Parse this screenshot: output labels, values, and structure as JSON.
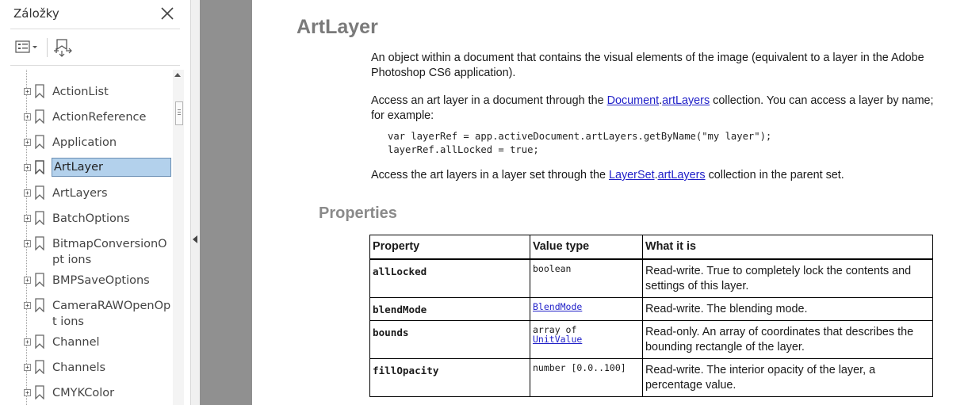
{
  "sidebar": {
    "title": "Záložky",
    "items": [
      {
        "label": "ActionList"
      },
      {
        "label": "ActionReference"
      },
      {
        "label": "Application"
      },
      {
        "label": "ArtLayer",
        "selected": true
      },
      {
        "label": "ArtLayers"
      },
      {
        "label": "BatchOptions"
      },
      {
        "label": "BitmapConversionOpt ions"
      },
      {
        "label": "BMPSaveOptions"
      },
      {
        "label": "CameraRAWOpenOpt ions"
      },
      {
        "label": "Channel"
      },
      {
        "label": "Channels"
      },
      {
        "label": "CMYKColor"
      }
    ],
    "icons": [
      "close-icon",
      "options-list-icon",
      "new-bookmark-icon",
      "bookmark-ribbon-icon",
      "plus-expander-icon"
    ]
  },
  "document": {
    "title": "ArtLayer",
    "intro": "An object within a document that contains the visual elements of the image (equivalent to a layer in the Adobe Photoshop CS6 application).",
    "access1": {
      "before": "Access an art layer in a document through the ",
      "link1": "Document",
      "dot": ".",
      "link2": "artLayers",
      "after": " collection. You can access a layer by name; for example:"
    },
    "code": "var layerRef = app.activeDocument.artLayers.getByName(\"my layer\");\nlayerRef.allLocked = true;",
    "access2": {
      "before": "Access the art layers in a layer set through the ",
      "link1": "LayerSet",
      "dot": ".",
      "link2": "artLayers",
      "after": " collection in the parent set."
    },
    "properties_title": "Properties",
    "table": {
      "headers": [
        "Property",
        "Value type",
        "What it is"
      ],
      "rows": [
        {
          "property": "allLocked",
          "type_line1": "boolean",
          "type_line2": "",
          "type_link": false,
          "desc": "Read-write. True to completely lock the contents and settings of this layer."
        },
        {
          "property": "blendMode",
          "type_line1": "",
          "type_line2": "BlendMode",
          "type_link": true,
          "desc": "Read-write. The blending mode."
        },
        {
          "property": "bounds",
          "type_line1": "array of",
          "type_line2": "UnitValue",
          "type_link": true,
          "desc": "Read-only. An array of coordinates that describes the bounding rectangle of the layer."
        },
        {
          "property": "fillOpacity",
          "type_line1": "number [0.0..100]",
          "type_line2": "",
          "type_link": false,
          "desc": "Read-write. The interior opacity of the layer, a percentage value."
        }
      ]
    }
  },
  "colors": {
    "link": "#1f1fc8",
    "selection": "#b3d1ec",
    "gutter": "#909090",
    "heading": "#7a7a7a"
  }
}
